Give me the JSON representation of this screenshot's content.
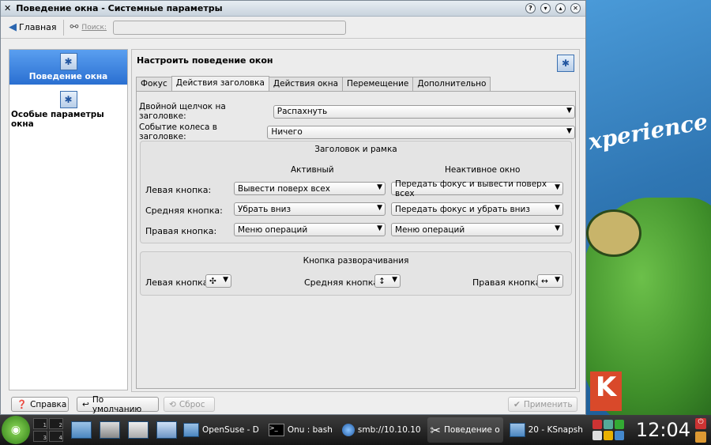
{
  "window": {
    "title": "Поведение окна - Системные параметры"
  },
  "toolbar": {
    "home_label": "Главная",
    "search_label": "Поиск:",
    "search_value": ""
  },
  "sidebar": {
    "items": [
      {
        "label": "Поведение окна",
        "selected": true
      },
      {
        "label": "Особые параметры окна",
        "selected": false
      }
    ]
  },
  "main": {
    "heading": "Настроить поведение окон",
    "tabs": [
      "Фокус",
      "Действия заголовка",
      "Действия окна",
      "Перемещение",
      "Дополнительно"
    ],
    "active_tab": "Действия заголовка",
    "dblclick_label": "Двойной щелчок на заголовке:",
    "dblclick_value": "Распахнуть",
    "wheel_label": "Событие колеса в заголовке:",
    "wheel_value": "Ничего",
    "frame_group": {
      "title": "Заголовок и рамка",
      "col_active": "Активный",
      "col_inactive": "Неактивное окно",
      "rows": [
        {
          "label": "Левая кнопка:",
          "active": "Вывести поверх всех",
          "inactive": "Передать фокус и вывести поверх всех"
        },
        {
          "label": "Средняя кнопка:",
          "active": "Убрать вниз",
          "inactive": "Передать фокус и убрать вниз"
        },
        {
          "label": "Правая кнопка:",
          "active": "Меню операций",
          "inactive": "Меню операций"
        }
      ]
    },
    "max_group": {
      "title": "Кнопка разворачивания",
      "left_label": "Левая кнопка:",
      "left_value": "✣",
      "mid_label": "Средняя кнопка:",
      "mid_value": "↕",
      "right_label": "Правая кнопка:",
      "right_value": "↔"
    }
  },
  "buttons": {
    "help": "Справка",
    "defaults": "По умолчанию",
    "reset": "Сброс",
    "apply": "Применить"
  },
  "taskbar": {
    "pager": [
      "1",
      "2",
      "3",
      "4"
    ],
    "tasks": [
      "OpenSuse - D",
      "Onu : bash",
      "smb://10.10.10",
      "Поведение о",
      "20 - KSnapsh"
    ],
    "clock": "12:04"
  },
  "desktop": {
    "text": "xperience"
  },
  "colors": {
    "selection": "#3b82e0",
    "taskbar": "#222222"
  }
}
